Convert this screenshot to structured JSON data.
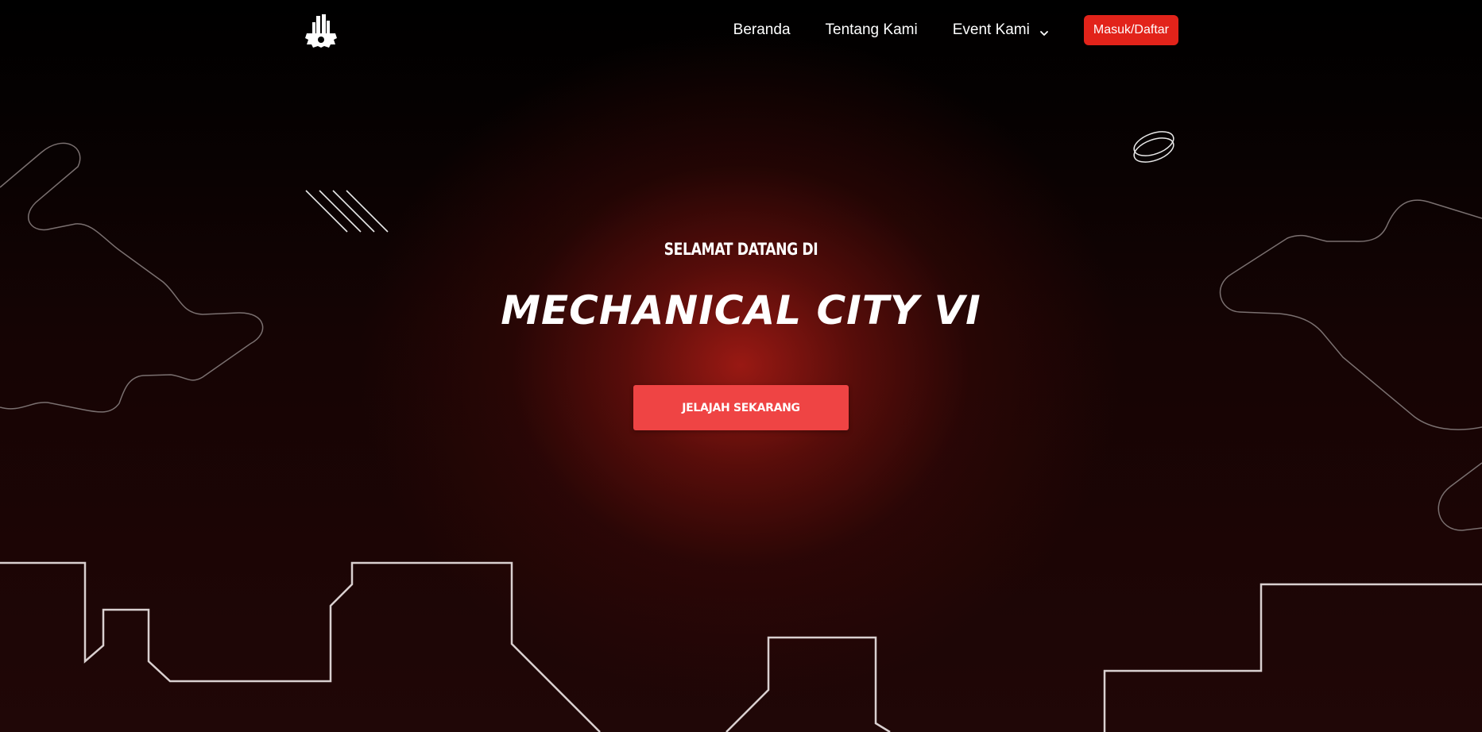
{
  "nav": {
    "logo_icon": "city-gear-logo",
    "items": [
      {
        "label": "Beranda"
      },
      {
        "label": "Tentang Kami"
      },
      {
        "label": "Event Kami",
        "icon": "chevron-down-icon"
      }
    ],
    "login_label": "Masuk/Daftar"
  },
  "hero": {
    "welcome": "SELAMAT DATANG DI",
    "title": "MECHANICAL CITY VI",
    "cta_label": "JELAJAH SEKARANG"
  },
  "colors": {
    "accent": "#e2231a",
    "cta": "#ef4444",
    "glow": "#8b1510",
    "background": "#000000"
  }
}
